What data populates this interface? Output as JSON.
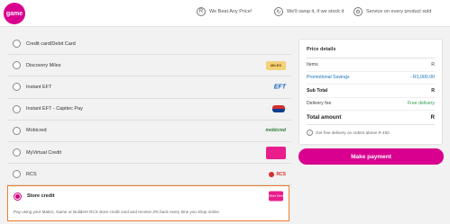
{
  "brand": {
    "logo_text": "game"
  },
  "header": {
    "promises": [
      {
        "icon": "price-icon",
        "glyph": "R",
        "text": "We Beat Any Price!"
      },
      {
        "icon": "swap-icon",
        "glyph": "↻",
        "text": "We'll swop it, if we stock it"
      },
      {
        "icon": "service-icon",
        "glyph": "⚙",
        "text": "Service on every product sold"
      }
    ]
  },
  "payment_methods": [
    {
      "label": "Credit card/Debit Card",
      "selected": false,
      "logo": ""
    },
    {
      "label": "Discovery Miles",
      "selected": false,
      "logo": "MILES"
    },
    {
      "label": "Instant EFT",
      "selected": false,
      "logo": "EFT"
    },
    {
      "label": "Instant EFT - Capitec Pay",
      "selected": false,
      "logo": ""
    },
    {
      "label": "Mobicred",
      "selected": false,
      "logo": "mobicred"
    },
    {
      "label": "MyVirtual Credit",
      "selected": false,
      "logo": ""
    },
    {
      "label": "RCS",
      "selected": false,
      "logo": "RCS"
    },
    {
      "label": "Store credit",
      "selected": true,
      "logo": "Store Card",
      "description": "Pay using your Makro, Game or Builders RCS store credit card and receive 3% back every time you shop online."
    }
  ],
  "summary": {
    "title": "Price details",
    "rows": [
      {
        "key": "Items",
        "value": "R"
      },
      {
        "key": "Promotional Savings",
        "value": "- R1,000.00"
      },
      {
        "key": "Sub Total",
        "value": "R"
      },
      {
        "key": "Delivery fee",
        "value": "Free delivery"
      }
    ],
    "total_label": "Total amount",
    "total_value": "R",
    "note": "Get free delivery on orders above R 450"
  },
  "actions": {
    "pay_label": "Make payment"
  },
  "colors": {
    "brand": "#d9008f",
    "selected_border": "#ef7c2a",
    "savings": "#1a73b8",
    "free": "#2e9d4a"
  }
}
